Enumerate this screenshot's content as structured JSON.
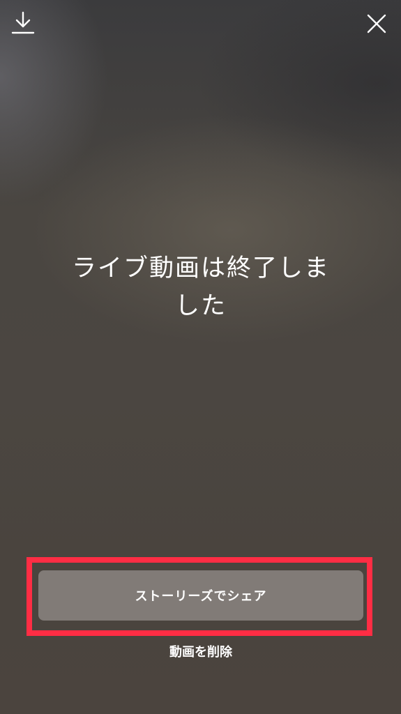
{
  "header": {
    "download_icon": "download-icon",
    "close_icon": "close-icon"
  },
  "main": {
    "headline": "ライブ動画は終了しました"
  },
  "actions": {
    "share_label": "ストーリーズでシェア",
    "delete_label": "動画を削除"
  },
  "colors": {
    "highlight_frame": "#ff2d44",
    "icon": "#ffffff"
  }
}
